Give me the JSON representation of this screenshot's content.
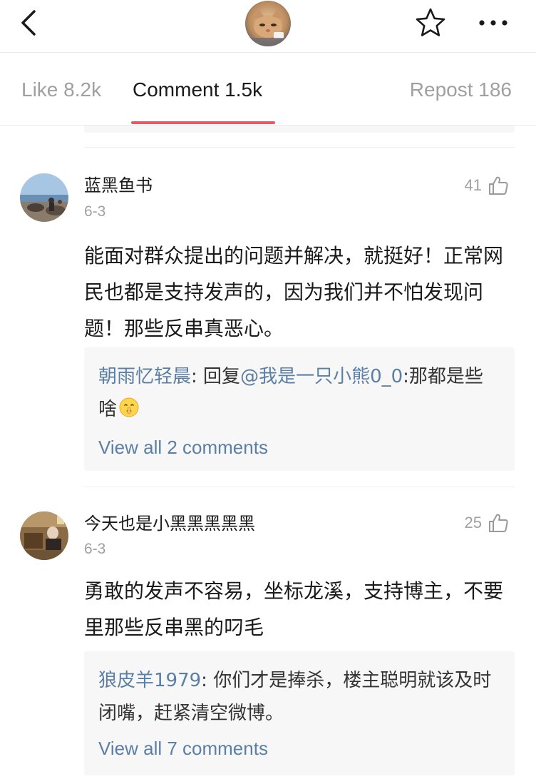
{
  "header": {
    "back_icon": "chevron-left-icon",
    "star_icon": "star-outline-icon",
    "more_icon": "more-horizontal-icon"
  },
  "tabs": [
    {
      "label": "Like 8.2k",
      "active": false
    },
    {
      "label": "Comment 1.5k",
      "active": true
    },
    {
      "label": "Repost 186",
      "active": false
    }
  ],
  "accent_color": "#e65862",
  "link_color": "#5b7fa4",
  "comments": [
    {
      "username": "蓝黑鱼书",
      "date": "6-3",
      "likes": "41",
      "text": "能面对群众提出的问题并解决，就挺好！正常网民也都是支持发声的，因为我们并不怕发现问题！那些反串真恶心。",
      "reply": {
        "user": "朝雨忆轻晨",
        "sep": ": ",
        "prefix": "回复",
        "mention": "@我是一只小熊0_0",
        "content": ":那都是些啥",
        "emoji": "shush-face-emoji"
      },
      "view_all": "View all 2 comments"
    },
    {
      "username": "今天也是小黑黑黑黑黑",
      "date": "6-3",
      "likes": "25",
      "text": "勇敢的发声不容易，坐标龙溪，支持博主，不要里那些反串黑的叼毛",
      "reply": {
        "user": "狼皮羊1979",
        "sep": ": ",
        "content": "你们才是捧杀，楼主聪明就该及时闭嘴，赶紧清空微博。"
      },
      "view_all": "View all 7 comments"
    }
  ]
}
